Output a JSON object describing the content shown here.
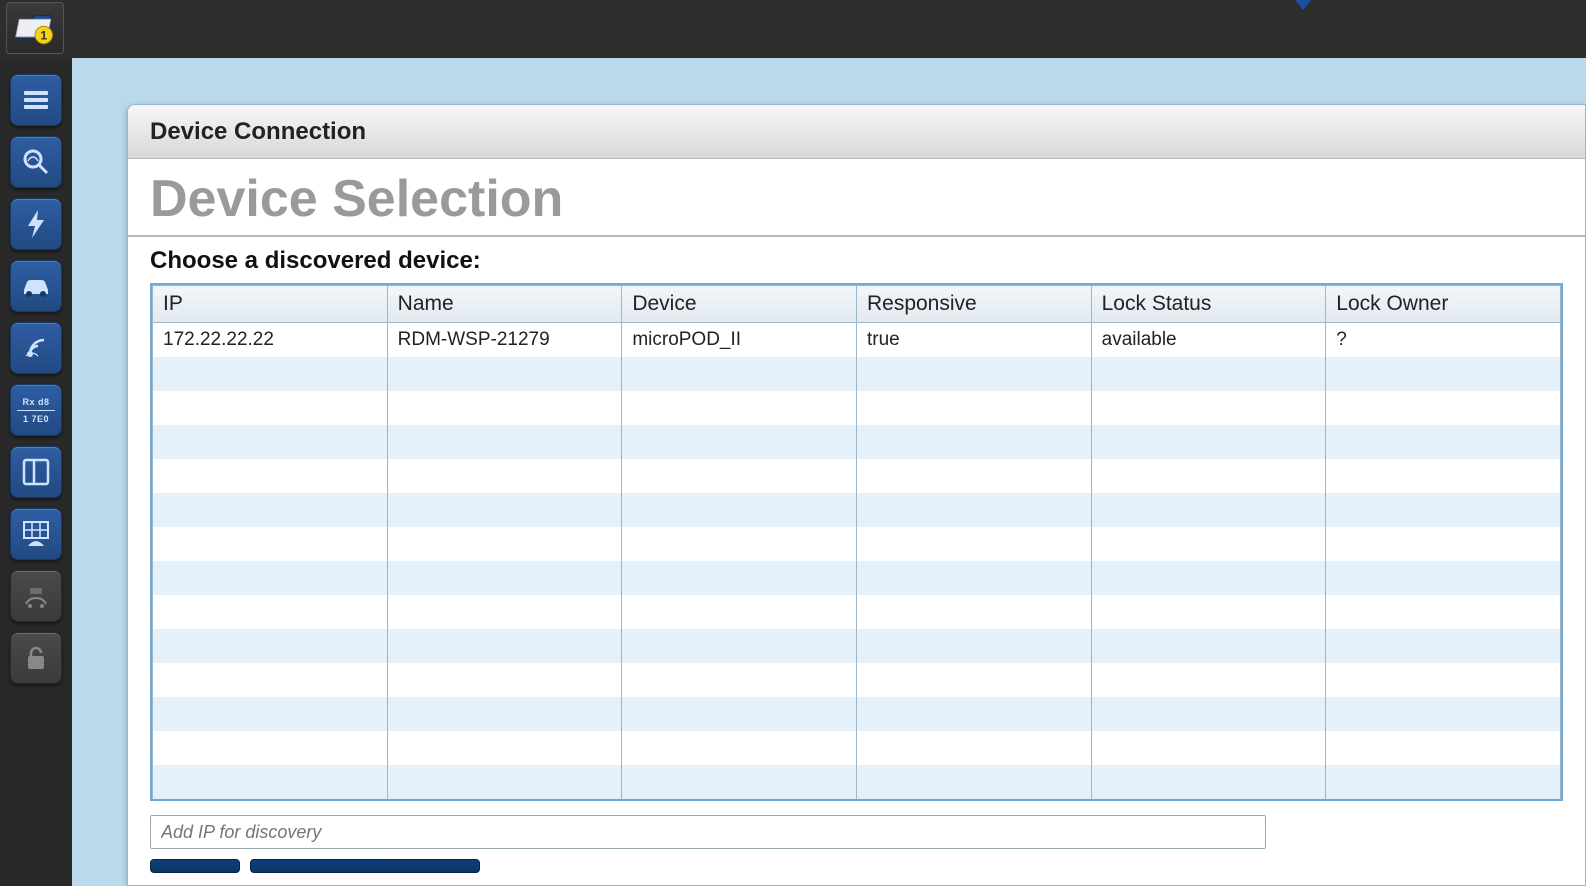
{
  "panel": {
    "header": "Device Connection",
    "title": "Device Selection",
    "subtitle": "Choose a discovered device:"
  },
  "table": {
    "columns": [
      "IP",
      "Name",
      "Device",
      "Responsive",
      "Lock Status",
      "Lock Owner"
    ],
    "rows": [
      {
        "ip": "172.22.22.22",
        "name": "RDM-WSP-21279",
        "device": "microPOD_II",
        "responsive": "true",
        "lock_status": "available",
        "lock_owner": "?"
      }
    ],
    "blank_rows": 13
  },
  "input": {
    "ip_placeholder": "Add IP for discovery"
  },
  "sidebar": {
    "items": [
      {
        "name": "menu",
        "icon": "menu-icon",
        "enabled": true
      },
      {
        "name": "diagnose",
        "icon": "search-car-icon",
        "enabled": true
      },
      {
        "name": "flash",
        "icon": "bolt-icon",
        "enabled": true
      },
      {
        "name": "vehicle",
        "icon": "car-icon",
        "enabled": true
      },
      {
        "name": "wireless",
        "icon": "signal-icon",
        "enabled": true
      },
      {
        "name": "raw-data",
        "icon": "rx-tx-icon",
        "enabled": true,
        "line1": "Rx d8",
        "line2": "1 7E0"
      },
      {
        "name": "layout",
        "icon": "layout-icon",
        "enabled": true
      },
      {
        "name": "table-car",
        "icon": "grid-car-icon",
        "enabled": true
      },
      {
        "name": "settings",
        "icon": "gauge-icon",
        "enabled": false
      },
      {
        "name": "lock",
        "icon": "lock-icon",
        "enabled": false
      }
    ]
  },
  "topbar": {
    "badge": "1"
  }
}
